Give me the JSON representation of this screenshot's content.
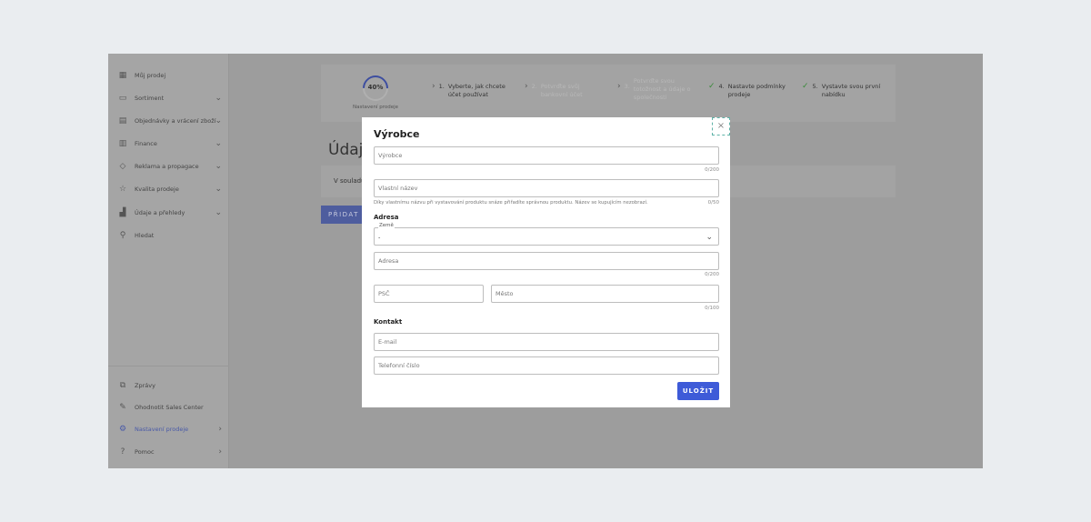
{
  "sidebar": {
    "items": [
      {
        "label": "Můj prodej",
        "icon": "dashboard-icon"
      },
      {
        "label": "Sortiment",
        "icon": "box-icon"
      },
      {
        "label": "Objednávky a vrácení zboží",
        "icon": "document-icon"
      },
      {
        "label": "Finance",
        "icon": "invoice-icon"
      },
      {
        "label": "Reklama a propagace",
        "icon": "tag-icon"
      },
      {
        "label": "Kvalita prodeje",
        "icon": "star-icon"
      },
      {
        "label": "Údaje a přehledy",
        "icon": "chart-icon"
      },
      {
        "label": "Hledat",
        "icon": "search-icon"
      }
    ],
    "bottom": [
      {
        "label": "Zprávy",
        "icon": "messages-icon"
      },
      {
        "label": "Ohodnotit Sales Center",
        "icon": "edit-icon"
      },
      {
        "label": "Nastavení prodeje",
        "icon": "gear-icon"
      },
      {
        "label": "Pomoc",
        "icon": "help-icon"
      }
    ]
  },
  "stepper": {
    "progress": "40%",
    "progress_value": 40,
    "label": "Nastavení prodeje",
    "steps": [
      {
        "num": "1.",
        "text": "Vyberte, jak chcete účet používat",
        "state": "current"
      },
      {
        "num": "2.",
        "text": "Potvrďte svůj bankovní účet",
        "state": "disabled"
      },
      {
        "num": "3.",
        "text": "Potvrďte svou totožnost a údaje o společnosti",
        "state": "disabled"
      },
      {
        "num": "4.",
        "text": "Nastavte podmínky prodeje",
        "state": "done"
      },
      {
        "num": "5.",
        "text": "Vystavte svou první nabídku",
        "state": "done"
      }
    ]
  },
  "page": {
    "heading": "Údaje",
    "notice": "V souladu",
    "add_button": "PŘIDAT V"
  },
  "modal": {
    "title": "Výrobce",
    "close": "×",
    "manufacturer": {
      "placeholder": "Výrobce",
      "counter": "0/200"
    },
    "custom_name": {
      "placeholder": "Vlastní název",
      "counter": "0/50",
      "hint": "Díky vlastnímu názvu při vystavování produktu snáze přiřadíte správnou produktu. Název se kupujícím nezobrazí."
    },
    "address_section": "Adresa",
    "country": {
      "label": "Země",
      "value": "-"
    },
    "address": {
      "placeholder": "Adresa",
      "counter": "0/200"
    },
    "zip": {
      "placeholder": "PSČ"
    },
    "city": {
      "placeholder": "Město",
      "counter": "0/100"
    },
    "contact_section": "Kontakt",
    "email": {
      "placeholder": "E-mail"
    },
    "phone": {
      "placeholder": "Telefonní číslo"
    },
    "save": "ULOŽIT"
  }
}
